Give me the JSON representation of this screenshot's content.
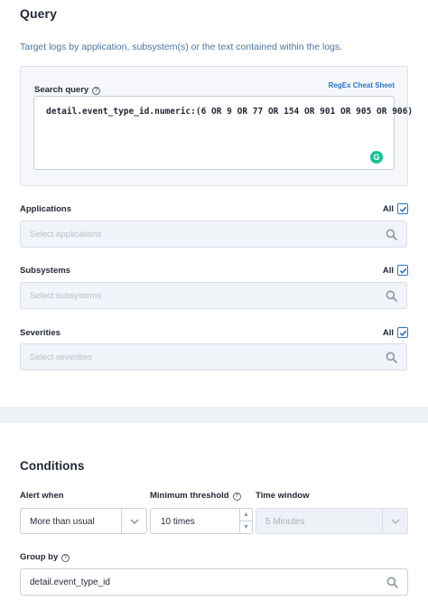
{
  "query": {
    "title": "Query",
    "subtitle": "Target logs by application, subsystem(s) or the text contained within the logs.",
    "search_query_label": "Search query",
    "regex_link": "RegEx Cheat Sheet",
    "query_text": "detail.event_type_id.numeric:(6 OR 9 OR 77 OR 154 OR 901 OR 905 OR 906)",
    "grammarly_glyph": "G"
  },
  "applications": {
    "label": "Applications",
    "all_label": "All",
    "checked": true,
    "placeholder": "Select applications"
  },
  "subsystems": {
    "label": "Subsystems",
    "all_label": "All",
    "checked": true,
    "placeholder": "Select subsystems"
  },
  "severities": {
    "label": "Severities",
    "all_label": "All",
    "checked": true,
    "placeholder": "Select severities"
  },
  "conditions": {
    "title": "Conditions",
    "alert_when": {
      "label": "Alert when",
      "value": "More than usual"
    },
    "minimum_threshold": {
      "label": "Minimum threshold",
      "value": "10 times"
    },
    "time_window": {
      "label": "Time window",
      "value": "5 Minutes"
    },
    "group_by": {
      "label": "Group by",
      "value": "detail.event_type_id"
    }
  },
  "colors": {
    "accent": "#2c74c7",
    "grammarly": "#15c39a",
    "subtitle": "#4a74a0"
  }
}
